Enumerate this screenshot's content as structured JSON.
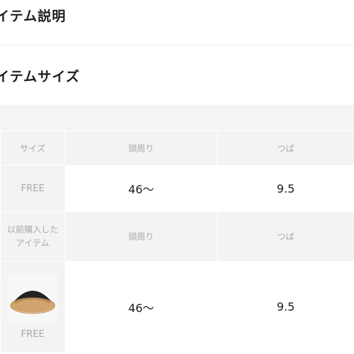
{
  "sections": {
    "description_title": "イテム説明",
    "size_title": "イテムサイズ"
  },
  "size_table": {
    "headers": [
      "サイズ",
      "頭周り",
      "つば"
    ],
    "rows": [
      {
        "size": "FREE",
        "head": "46〜",
        "brim": "9.5"
      }
    ]
  },
  "purchased_table": {
    "label": "以前購入した\nアイテム",
    "headers": [
      "頭周り",
      "つば"
    ],
    "rows": [
      {
        "size": "FREE",
        "head": "46〜",
        "brim": "9.5",
        "image_icon": "sun-visor-hat-icon"
      }
    ]
  }
}
